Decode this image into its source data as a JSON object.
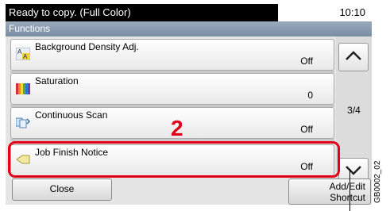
{
  "status": {
    "message": "Ready to copy. (Full Color)",
    "time": "10:10"
  },
  "title": "Functions",
  "rows": [
    {
      "label": "Background Density Adj.",
      "value": "Off",
      "icon": "background-density-icon"
    },
    {
      "label": "Saturation",
      "value": "0",
      "icon": "saturation-icon"
    },
    {
      "label": "Continuous Scan",
      "value": "Off",
      "icon": "continuous-scan-icon"
    },
    {
      "label": "Job Finish Notice",
      "value": "Off",
      "icon": "job-finish-notice-icon"
    }
  ],
  "page_indicator": "3/4",
  "buttons": {
    "close": "Close",
    "shortcut_line1": "Add/Edit",
    "shortcut_line2": "Shortcut"
  },
  "annotations": {
    "step_number": "2",
    "figure_code": "GB0002_02"
  },
  "colors": {
    "highlight": "#e2001a",
    "title_bar": "#8a9bb0"
  }
}
